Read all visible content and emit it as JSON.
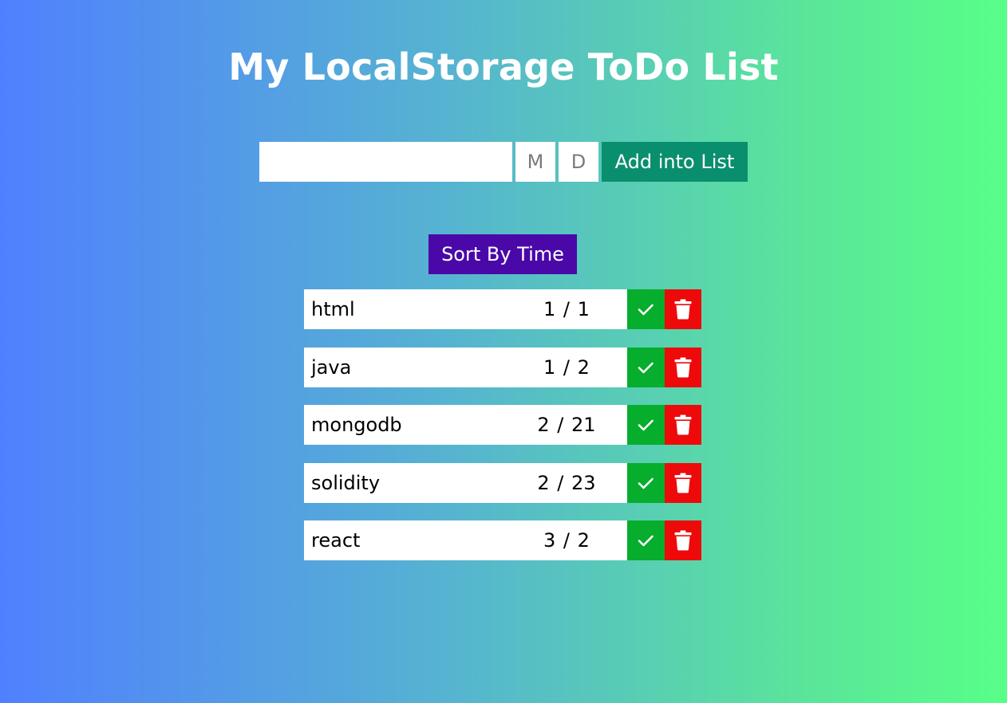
{
  "header": {
    "title": "My LocalStorage ToDo List"
  },
  "add_form": {
    "task_value": "",
    "task_placeholder": "",
    "month_placeholder": "M",
    "day_placeholder": "D",
    "add_label": "Add into List"
  },
  "sort": {
    "label": "Sort By Time"
  },
  "todos": [
    {
      "text": "html",
      "date": "1 / 1"
    },
    {
      "text": "java",
      "date": "1 / 2"
    },
    {
      "text": "mongodb",
      "date": "2 / 21"
    },
    {
      "text": "solidity",
      "date": "2 / 23"
    },
    {
      "text": "react",
      "date": "3 / 2"
    }
  ],
  "icons": {
    "done": "check-icon",
    "delete": "trash-icon"
  },
  "colors": {
    "gradient_start": "#5080ff",
    "gradient_end": "#58ff88",
    "add_button": "#0a8f6e",
    "sort_button": "#4b08a8",
    "done_button": "#07ad2c",
    "delete_button": "#ee0a0a"
  }
}
